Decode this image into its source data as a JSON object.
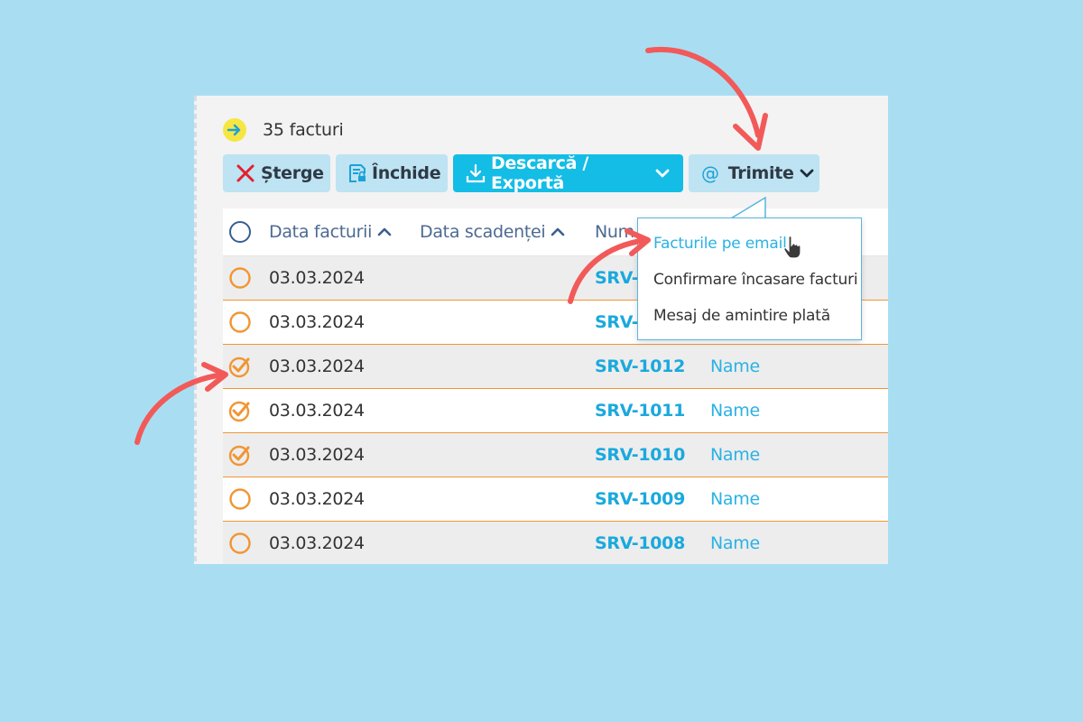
{
  "header": {
    "count_text": "35 facturi"
  },
  "toolbar": {
    "delete_label": "Șterge",
    "close_label": "Închide",
    "export_label": "Descarcă / Exportă",
    "send_label": "Trimite"
  },
  "table": {
    "columns": {
      "invoice_date": "Data facturii",
      "due_date": "Data scadenței",
      "number": "Num"
    },
    "rows": [
      {
        "date": "03.03.2024",
        "number": "SRV-",
        "name": "",
        "checked": false
      },
      {
        "date": "03.03.2024",
        "number": "SRV-",
        "name": "",
        "checked": false
      },
      {
        "date": "03.03.2024",
        "number": "SRV-1012",
        "name": "Name",
        "checked": true
      },
      {
        "date": "03.03.2024",
        "number": "SRV-1011",
        "name": "Name",
        "checked": true
      },
      {
        "date": "03.03.2024",
        "number": "SRV-1010",
        "name": "Name",
        "checked": true
      },
      {
        "date": "03.03.2024",
        "number": "SRV-1009",
        "name": "Name",
        "checked": false
      },
      {
        "date": "03.03.2024",
        "number": "SRV-1008",
        "name": "Name",
        "checked": false
      }
    ]
  },
  "send_menu": {
    "items": [
      "Facturile pe email",
      "Confirmare încasare facturi",
      "Mesaj de amintire plată"
    ],
    "highlighted": "Facturile pe email"
  },
  "colors": {
    "background": "#a9def2",
    "accent": "#14bde6",
    "checkbox": "#f19533",
    "annotation_arrow": "#f25a5a"
  },
  "icons": {
    "count": "arrow-right-icon",
    "delete": "x-icon",
    "close": "lock-doc-icon",
    "export": "download-icon",
    "send": "at-icon"
  }
}
